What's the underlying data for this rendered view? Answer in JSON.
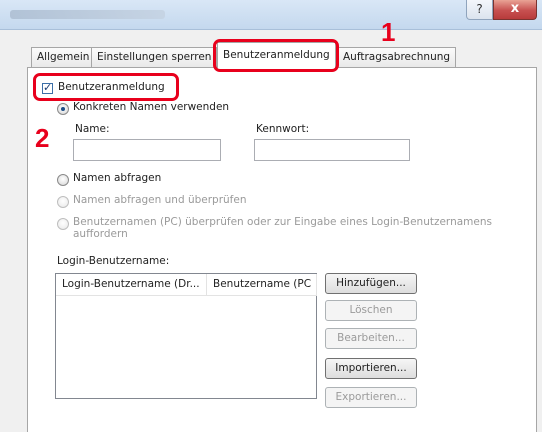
{
  "window": {
    "help_label": "?",
    "close_label": "x"
  },
  "tabs": [
    {
      "label": "Allgemein"
    },
    {
      "label": "Einstellungen sperren"
    },
    {
      "label": "Benutzeranmeldung"
    },
    {
      "label": "Auftragsabrechnung"
    }
  ],
  "active_tab": "Benutzeranmeldung",
  "user_login": {
    "checkbox_label": "Benutzeranmeldung",
    "checked": true
  },
  "radio_specific": {
    "label": "Konkreten Namen verwenden",
    "selected": true
  },
  "fields": {
    "name_label": "Name:",
    "name_value": "",
    "password_label": "Kennwort:",
    "password_value": ""
  },
  "radios": [
    {
      "label": "Namen abfragen",
      "enabled": true
    },
    {
      "label": "Namen abfragen und überprüfen",
      "enabled": false
    },
    {
      "label_line1": "Benutzernamen (PC) überprüfen oder zur Eingabe eines Login-Benutzernamens",
      "label_line2": "auffordern",
      "enabled": false
    }
  ],
  "login_list": {
    "label": "Login-Benutzername:",
    "columns": [
      "Login-Benutzername (Dr...",
      "Benutzername (PC"
    ]
  },
  "buttons": {
    "add": "Hinzufügen...",
    "delete": "Löschen",
    "edit": "Bearbeiten...",
    "import": "Importieren...",
    "export": "Exportieren..."
  },
  "callouts": {
    "one": "1",
    "two": "2"
  },
  "colors": {
    "highlight": "#e8001c",
    "close_button": "#c75050"
  }
}
